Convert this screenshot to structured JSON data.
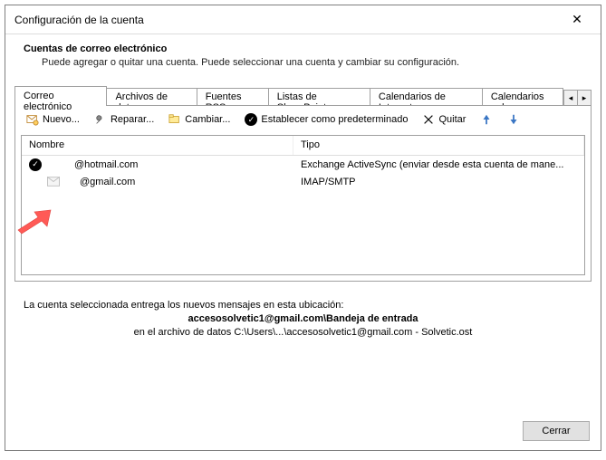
{
  "window": {
    "title": "Configuración de la cuenta"
  },
  "header": {
    "title": "Cuentas de correo electrónico",
    "description": "Puede agregar o quitar una cuenta. Puede seleccionar una cuenta y cambiar su configuración."
  },
  "tabs": {
    "items": [
      {
        "label": "Correo electrónico",
        "active": true
      },
      {
        "label": "Archivos de datos"
      },
      {
        "label": "Fuentes RSS"
      },
      {
        "label": "Listas de SharePoint"
      },
      {
        "label": "Calendarios de Internet"
      },
      {
        "label": "Calendarios pul"
      }
    ],
    "nav_left": "◂",
    "nav_right": "▸"
  },
  "toolbar": {
    "nuevo": "Nuevo...",
    "reparar": "Reparar...",
    "cambiar": "Cambiar...",
    "default": "Establecer como predeterminado",
    "quitar": "Quitar"
  },
  "table": {
    "cols": {
      "nombre": "Nombre",
      "tipo": "Tipo"
    },
    "rows": [
      {
        "email": "@hotmail.com",
        "tipo": "Exchange ActiveSync (enviar desde esta cuenta de mane...",
        "is_default": true
      },
      {
        "email": "@gmail.com",
        "tipo": "IMAP/SMTP",
        "is_default": false
      }
    ]
  },
  "info": {
    "line1": "La cuenta seleccionada entrega los nuevos mensajes en esta ubicación:",
    "line2": "accesosolvetic1@gmail.com\\Bandeja de entrada",
    "line3": "en el archivo de datos C:\\Users\\...\\accesosolvetic1@gmail.com - Solvetic.ost"
  },
  "footer": {
    "close": "Cerrar"
  }
}
